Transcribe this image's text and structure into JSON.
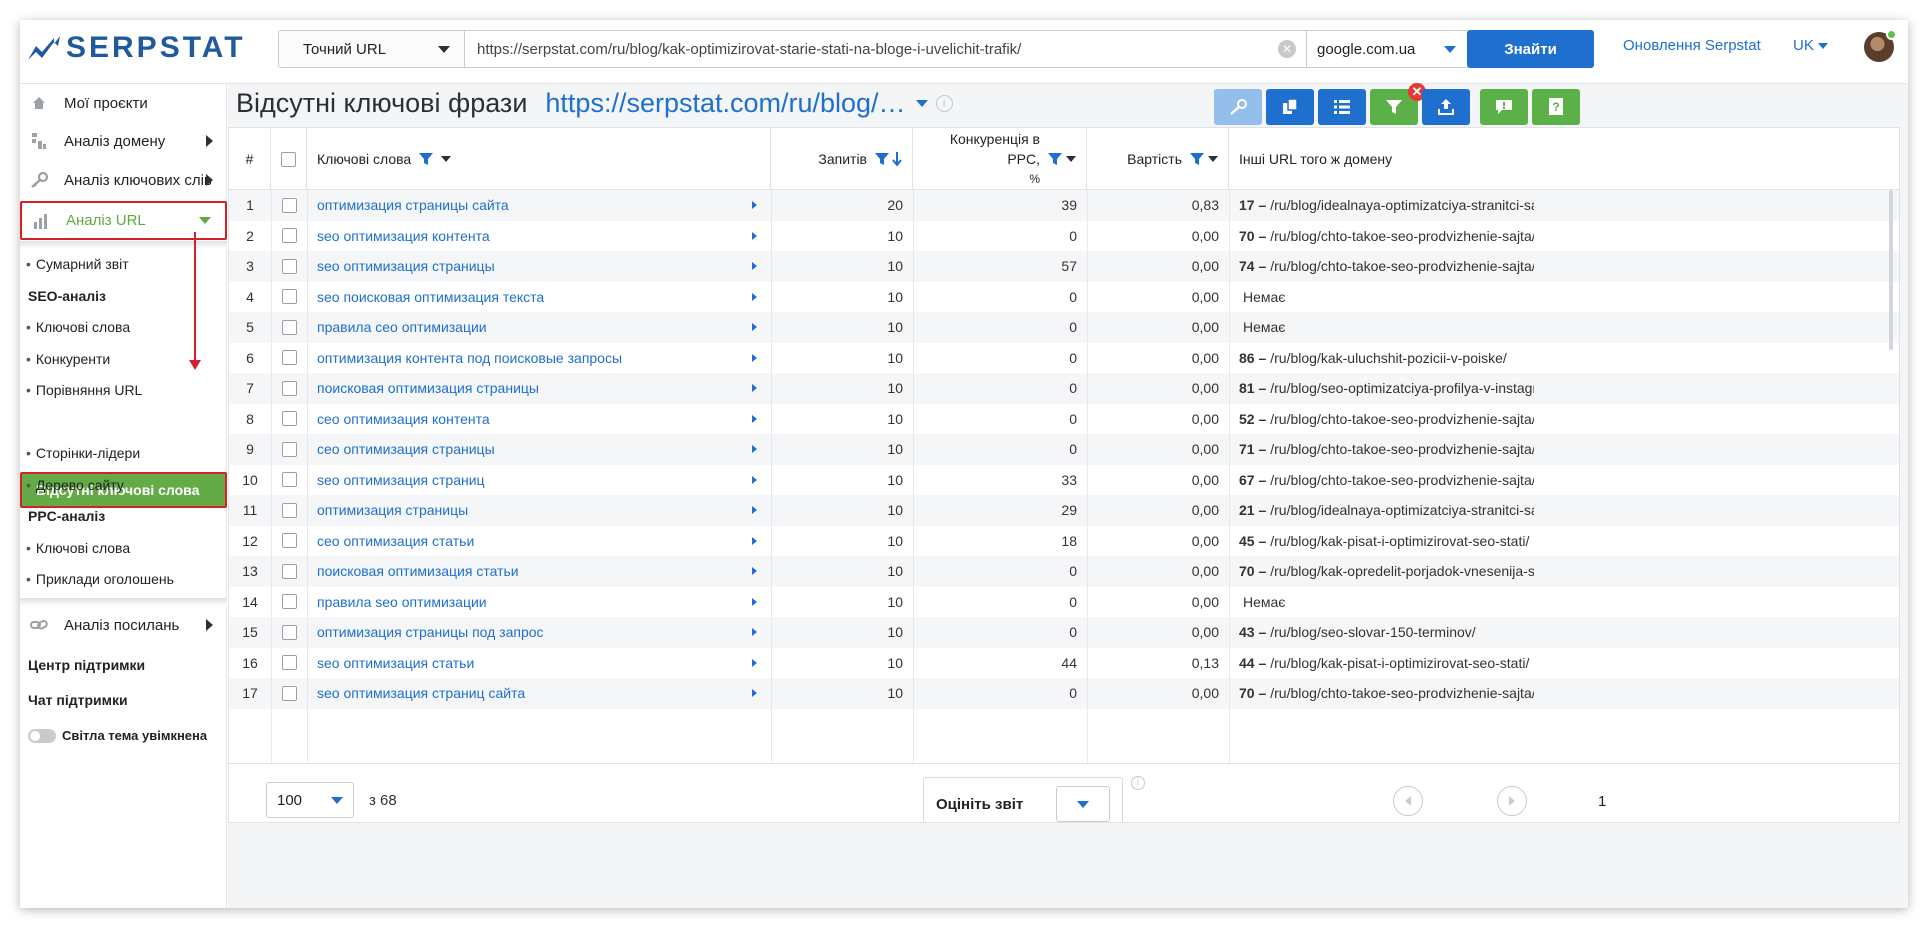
{
  "brand": {
    "name": "SERPSTAT"
  },
  "search": {
    "mode_label": "Точний URL",
    "url_value": "https://serpstat.com/ru/blog/kak-optimizirovat-starie-stati-na-bloge-i-uvelichit-trafik/",
    "engine_label": "google.com.ua",
    "button_label": "Знайти"
  },
  "header": {
    "updates_label": "Оновлення Serpstat",
    "lang_label": "UK"
  },
  "sidebar": {
    "my_projects": "Мої проєкти",
    "domain_analysis": "Аналіз домену",
    "keyword_analysis": "Аналіз ключових слів",
    "url_analysis": "Аналіз URL",
    "summary": "Сумарний звіт",
    "seo_heading": "SEO-аналіз",
    "seo_keywords": "Ключові слова",
    "competitors": "Конкуренти",
    "url_comparison": "Порівняння URL",
    "missing_keywords": "Відсутні ключові слова",
    "top_pages": "Сторінки-лідери",
    "site_tree": "Дерево сайту",
    "ppc_heading": "PPC-аналіз",
    "ppc_keywords": "Ключові слова",
    "ad_examples": "Приклади оголошень",
    "link_analysis": "Аналіз посилань",
    "support_center": "Центр підтримки",
    "support_chat": "Чат підтримки",
    "theme_toggle": "Світла тема увімкнена"
  },
  "page": {
    "title": "Відсутні ключові фрази",
    "url_short": "https://serpstat.com/ru/blog/…"
  },
  "table": {
    "columns": {
      "num": "#",
      "keyword": "Ключові слова",
      "volume": "Запитів",
      "competition_line1": "Конкуренція в PPC,",
      "competition_line2": "%",
      "cost": "Вартість",
      "other_urls": "Інші URL того ж домену"
    },
    "rows": [
      {
        "n": "1",
        "kw": "оптимизация страницы сайта",
        "vol": "20",
        "comp": "39",
        "cost": "0,83",
        "cnt": "17 –",
        "url": "/ru/blog/idealnaya-optimizatciya-stranitci-sajt…"
      },
      {
        "n": "2",
        "kw": "seo оптимизация контента",
        "vol": "10",
        "comp": "0",
        "cost": "0,00",
        "cnt": "70 –",
        "url": "/ru/blog/chto-takoe-seo-prodvizhenie-sajta/"
      },
      {
        "n": "3",
        "kw": "seo оптимизация страницы",
        "vol": "10",
        "comp": "57",
        "cost": "0,00",
        "cnt": "74 –",
        "url": "/ru/blog/chto-takoe-seo-prodvizhenie-sajta/"
      },
      {
        "n": "4",
        "kw": "seo поисковая оптимизация текста",
        "vol": "10",
        "comp": "0",
        "cost": "0,00",
        "cnt": "",
        "url": "Немає"
      },
      {
        "n": "5",
        "kw": "правила сео оптимизации",
        "vol": "10",
        "comp": "0",
        "cost": "0,00",
        "cnt": "",
        "url": "Немає"
      },
      {
        "n": "6",
        "kw": "оптимизация контента под поисковые запросы",
        "vol": "10",
        "comp": "0",
        "cost": "0,00",
        "cnt": "86 –",
        "url": "/ru/blog/kak-uluchshit-pozicii-v-poiske/"
      },
      {
        "n": "7",
        "kw": "поисковая оптимизация страницы",
        "vol": "10",
        "comp": "0",
        "cost": "0,00",
        "cnt": "81 –",
        "url": "/ru/blog/seo-optimizatciya-profilya-v-instagra…"
      },
      {
        "n": "8",
        "kw": "сео оптимизация контента",
        "vol": "10",
        "comp": "0",
        "cost": "0,00",
        "cnt": "52 –",
        "url": "/ru/blog/chto-takoe-seo-prodvizhenie-sajta/"
      },
      {
        "n": "9",
        "kw": "сео оптимизация страницы",
        "vol": "10",
        "comp": "0",
        "cost": "0,00",
        "cnt": "71 –",
        "url": "/ru/blog/chto-takoe-seo-prodvizhenie-sajta/"
      },
      {
        "n": "10",
        "kw": "seo оптимизация страниц",
        "vol": "10",
        "comp": "33",
        "cost": "0,00",
        "cnt": "67 –",
        "url": "/ru/blog/chto-takoe-seo-prodvizhenie-sajta/"
      },
      {
        "n": "11",
        "kw": "оптимизация страницы",
        "vol": "10",
        "comp": "29",
        "cost": "0,00",
        "cnt": "21 –",
        "url": "/ru/blog/idealnaya-optimizatciya-stranitci-sajt…"
      },
      {
        "n": "12",
        "kw": "сео оптимизация статьи",
        "vol": "10",
        "comp": "18",
        "cost": "0,00",
        "cnt": "45 –",
        "url": "/ru/blog/kak-pisat-i-optimizirovat-seo-stati/"
      },
      {
        "n": "13",
        "kw": "поисковая оптимизация статьи",
        "vol": "10",
        "comp": "0",
        "cost": "0,00",
        "cnt": "70 –",
        "url": "/ru/blog/kak-opredelit-porjadok-vnesenija-se…"
      },
      {
        "n": "14",
        "kw": "правила seo оптимизации",
        "vol": "10",
        "comp": "0",
        "cost": "0,00",
        "cnt": "",
        "url": "Немає"
      },
      {
        "n": "15",
        "kw": "оптимизация страницы под запрос",
        "vol": "10",
        "comp": "0",
        "cost": "0,00",
        "cnt": "43 –",
        "url": "/ru/blog/seo-slovar-150-terminov/"
      },
      {
        "n": "16",
        "kw": "seo оптимизация статьи",
        "vol": "10",
        "comp": "44",
        "cost": "0,13",
        "cnt": "44 –",
        "url": "/ru/blog/kak-pisat-i-optimizirovat-seo-stati/"
      },
      {
        "n": "17",
        "kw": "seo оптимизация страниц сайта",
        "vol": "10",
        "comp": "0",
        "cost": "0,00",
        "cnt": "70 –",
        "url": "/ru/blog/chto-takoe-seo-prodvizhenie-sajta/"
      }
    ]
  },
  "footer": {
    "per_page": "100",
    "of_total": "з 68",
    "rate_label": "Оцініть звіт",
    "current_page": "1"
  },
  "colors": {
    "accent_blue": "#1e6fce",
    "active_green": "#64aa46",
    "highlight_red": "#d42028"
  }
}
